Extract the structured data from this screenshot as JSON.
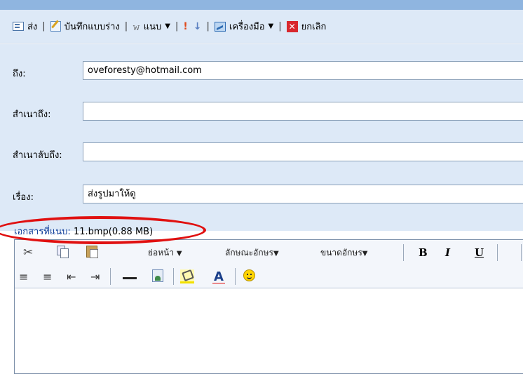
{
  "toolbar": {
    "send": "ส่ง",
    "save_draft": "บันทึกแบบร่าง",
    "attach": "แนบ",
    "tools": "เครื่องมือ",
    "cancel": "ยกเลิก",
    "icons": [
      "compose-icon",
      "draft-icon",
      "paperclip-icon",
      "high-priority-icon",
      "low-priority-icon",
      "tools-icon",
      "cancel-icon"
    ]
  },
  "form": {
    "to_label": "ถึง:",
    "to_value": "oveforesty@hotmail.com",
    "cc_label": "สำเนาถึง:",
    "cc_value": "",
    "bcc_label": "สำเนาลับถึง:",
    "bcc_value": "",
    "subject_label": "เรื่อง:",
    "subject_value": "ส่งรูปมาให้ดู"
  },
  "attachment": {
    "label": "เอกสารที่แนบ:",
    "file": "11.bmp(0.88 MB)",
    "highlight_color": "#e01010"
  },
  "editor": {
    "paragraph_dropdown": "ย่อหน้า",
    "font_dropdown": "ลักษณะอักษร",
    "size_dropdown": "ขนาดอักษร",
    "bold": "B",
    "italic": "I",
    "underline": "U",
    "font_color_glyph": "A"
  },
  "colors": {
    "toolbar_bg": "#dde9f7",
    "form_bg": "#dde9f7",
    "attachment_label": "#103e9a",
    "cancel_icon": "#d8282d"
  }
}
